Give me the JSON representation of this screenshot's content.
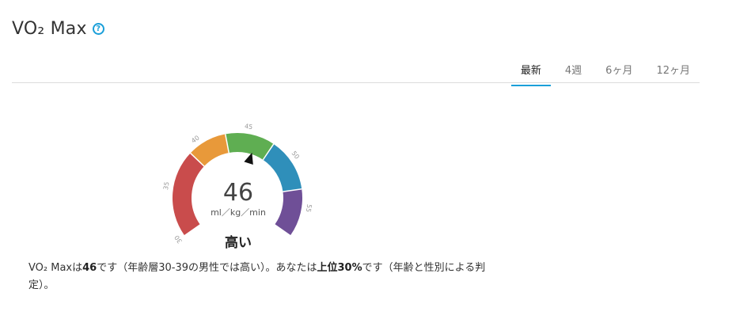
{
  "header": {
    "title": "VO₂ Max",
    "help_icon": "question-circle-icon",
    "help_glyph": "?"
  },
  "tabs": [
    {
      "label": "最新",
      "active": true
    },
    {
      "label": "4週",
      "active": false
    },
    {
      "label": "6ヶ月",
      "active": false
    },
    {
      "label": "12ヶ月",
      "active": false
    }
  ],
  "gauge": {
    "value": "46",
    "unit": "ml／kg／min",
    "status": "高い",
    "pointer_value": 46,
    "scale_min": 30,
    "scale_max": 58,
    "tick_labels": [
      "30",
      "35",
      "40",
      "45",
      "50",
      "55"
    ],
    "tick_values": [
      30,
      35,
      40,
      45,
      50,
      55
    ],
    "zones": [
      {
        "from": 30,
        "to": 38.8,
        "color": "#c94c4c"
      },
      {
        "from": 38.8,
        "to": 42.8,
        "color": "#e8993a"
      },
      {
        "from": 42.8,
        "to": 47.8,
        "color": "#5fae52"
      },
      {
        "from": 47.8,
        "to": 53.2,
        "color": "#2f8fba"
      },
      {
        "from": 53.2,
        "to": 58,
        "color": "#6f4f97"
      }
    ]
  },
  "description": {
    "p1": "VO₂ Maxは",
    "value": "46",
    "p2": "です（年齢層30-39の男性では高い）。あなたは",
    "rank": "上位30%",
    "p3": "です（年齢と性別による判定）。"
  }
}
